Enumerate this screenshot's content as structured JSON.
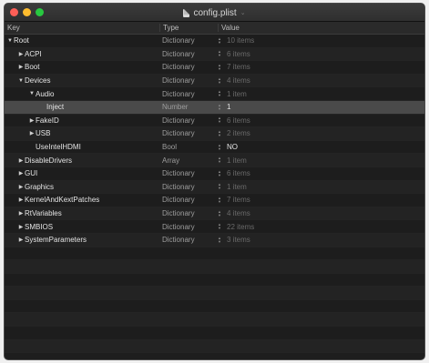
{
  "window": {
    "title": "config.plist"
  },
  "header": {
    "key": "Key",
    "type": "Type",
    "value": "Value"
  },
  "rows": [
    {
      "key": "Root",
      "depth": 0,
      "disclosure": "open",
      "type": "Dictionary",
      "value": "10 items",
      "selected": false,
      "strong": false
    },
    {
      "key": "ACPI",
      "depth": 1,
      "disclosure": "closed",
      "type": "Dictionary",
      "value": "6 items",
      "selected": false,
      "strong": false
    },
    {
      "key": "Boot",
      "depth": 1,
      "disclosure": "closed",
      "type": "Dictionary",
      "value": "7 items",
      "selected": false,
      "strong": false
    },
    {
      "key": "Devices",
      "depth": 1,
      "disclosure": "open",
      "type": "Dictionary",
      "value": "4 items",
      "selected": false,
      "strong": false
    },
    {
      "key": "Audio",
      "depth": 2,
      "disclosure": "open",
      "type": "Dictionary",
      "value": "1 item",
      "selected": false,
      "strong": false
    },
    {
      "key": "Inject",
      "depth": 3,
      "disclosure": "none",
      "type": "Number",
      "value": "1",
      "selected": true,
      "strong": true
    },
    {
      "key": "FakeID",
      "depth": 2,
      "disclosure": "closed",
      "type": "Dictionary",
      "value": "6 items",
      "selected": false,
      "strong": false
    },
    {
      "key": "USB",
      "depth": 2,
      "disclosure": "closed",
      "type": "Dictionary",
      "value": "2 items",
      "selected": false,
      "strong": false
    },
    {
      "key": "UseIntelHDMI",
      "depth": 2,
      "disclosure": "none",
      "type": "Bool",
      "value": "NO",
      "selected": false,
      "strong": true
    },
    {
      "key": "DisableDrivers",
      "depth": 1,
      "disclosure": "closed",
      "type": "Array",
      "value": "1 item",
      "selected": false,
      "strong": false
    },
    {
      "key": "GUI",
      "depth": 1,
      "disclosure": "closed",
      "type": "Dictionary",
      "value": "6 items",
      "selected": false,
      "strong": false
    },
    {
      "key": "Graphics",
      "depth": 1,
      "disclosure": "closed",
      "type": "Dictionary",
      "value": "1 item",
      "selected": false,
      "strong": false
    },
    {
      "key": "KernelAndKextPatches",
      "depth": 1,
      "disclosure": "closed",
      "type": "Dictionary",
      "value": "7 items",
      "selected": false,
      "strong": false
    },
    {
      "key": "RtVariables",
      "depth": 1,
      "disclosure": "closed",
      "type": "Dictionary",
      "value": "4 items",
      "selected": false,
      "strong": false
    },
    {
      "key": "SMBIOS",
      "depth": 1,
      "disclosure": "closed",
      "type": "Dictionary",
      "value": "22 items",
      "selected": false,
      "strong": false
    },
    {
      "key": "SystemParameters",
      "depth": 1,
      "disclosure": "closed",
      "type": "Dictionary",
      "value": "3 items",
      "selected": false,
      "strong": false
    }
  ]
}
